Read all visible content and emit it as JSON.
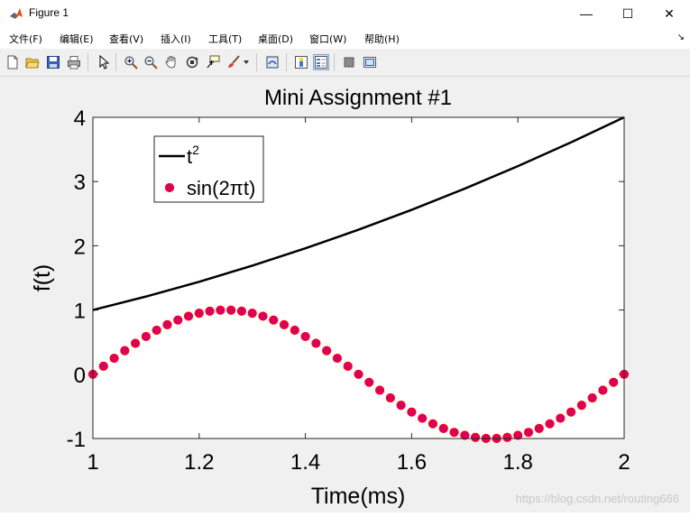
{
  "window": {
    "title": "Figure 1",
    "minimize": "—",
    "maximize": "☐",
    "close": "✕"
  },
  "menu": {
    "items": [
      "文件(F)",
      "编辑(E)",
      "查看(V)",
      "插入(I)",
      "工具(T)",
      "桌面(D)",
      "窗口(W)",
      "帮助(H)"
    ],
    "overflow": "↘"
  },
  "toolbar": {
    "icons": [
      "new-figure-icon",
      "open-file-icon",
      "save-icon",
      "print-icon",
      "pointer-icon",
      "zoom-in-icon",
      "zoom-out-icon",
      "pan-hand-icon",
      "rotate-3d-icon",
      "data-cursor-icon",
      "brush-icon",
      "brush-dropdown-icon",
      "link-plot-icon",
      "colorbar-icon",
      "legend-icon",
      "hide-plot-tools-icon",
      "show-plot-tools-icon"
    ]
  },
  "watermark": "https://blog.csdn.net/routing666",
  "chart_data": {
    "type": "line",
    "title": "Mini Assignment #1",
    "xlabel": "Time(ms)",
    "ylabel": "f(t)",
    "xlim": [
      1,
      2
    ],
    "ylim": [
      -1,
      4
    ],
    "xticks": [
      "1",
      "1.2",
      "1.4",
      "1.6",
      "1.8",
      "2"
    ],
    "yticks": [
      "-1",
      "0",
      "1",
      "2",
      "3",
      "4"
    ],
    "grid": false,
    "legend_position": "top-left",
    "legend": [
      {
        "label": "t",
        "sup": "2",
        "style": "line",
        "color": "#000000"
      },
      {
        "label": "sin(2πt)",
        "style": "markers",
        "color": "#ff0000",
        "fill": "#d6006a"
      }
    ],
    "series": [
      {
        "name": "t^2",
        "style": "line",
        "x": [
          1.0,
          1.1,
          1.2,
          1.3,
          1.4,
          1.5,
          1.6,
          1.7,
          1.8,
          1.9,
          2.0
        ],
        "values": [
          1.0,
          1.21,
          1.44,
          1.69,
          1.96,
          2.25,
          2.56,
          2.89,
          3.24,
          3.61,
          4.0
        ]
      },
      {
        "name": "sin(2πt)",
        "style": "markers",
        "x": [
          1.0,
          1.02,
          1.04,
          1.06,
          1.08,
          1.1,
          1.12,
          1.14,
          1.16,
          1.18,
          1.2,
          1.22,
          1.24,
          1.26,
          1.28,
          1.3,
          1.32,
          1.34,
          1.36,
          1.38,
          1.4,
          1.42,
          1.44,
          1.46,
          1.48,
          1.5,
          1.52,
          1.54,
          1.56,
          1.58,
          1.6,
          1.62,
          1.64,
          1.66,
          1.68,
          1.7,
          1.72,
          1.74,
          1.76,
          1.78,
          1.8,
          1.82,
          1.84,
          1.86,
          1.88,
          1.9,
          1.92,
          1.94,
          1.96,
          1.98,
          2.0
        ],
        "values": [
          0,
          0.125,
          0.249,
          0.368,
          0.482,
          0.588,
          0.685,
          0.771,
          0.844,
          0.904,
          0.951,
          0.982,
          0.998,
          0.998,
          0.982,
          0.951,
          0.904,
          0.844,
          0.771,
          0.685,
          0.588,
          0.482,
          0.368,
          0.249,
          0.125,
          0,
          -0.125,
          -0.249,
          -0.368,
          -0.482,
          -0.588,
          -0.685,
          -0.771,
          -0.844,
          -0.904,
          -0.951,
          -0.982,
          -0.998,
          -0.998,
          -0.982,
          -0.951,
          -0.904,
          -0.844,
          -0.771,
          -0.685,
          -0.588,
          -0.482,
          -0.368,
          -0.249,
          -0.125,
          0
        ]
      }
    ]
  }
}
